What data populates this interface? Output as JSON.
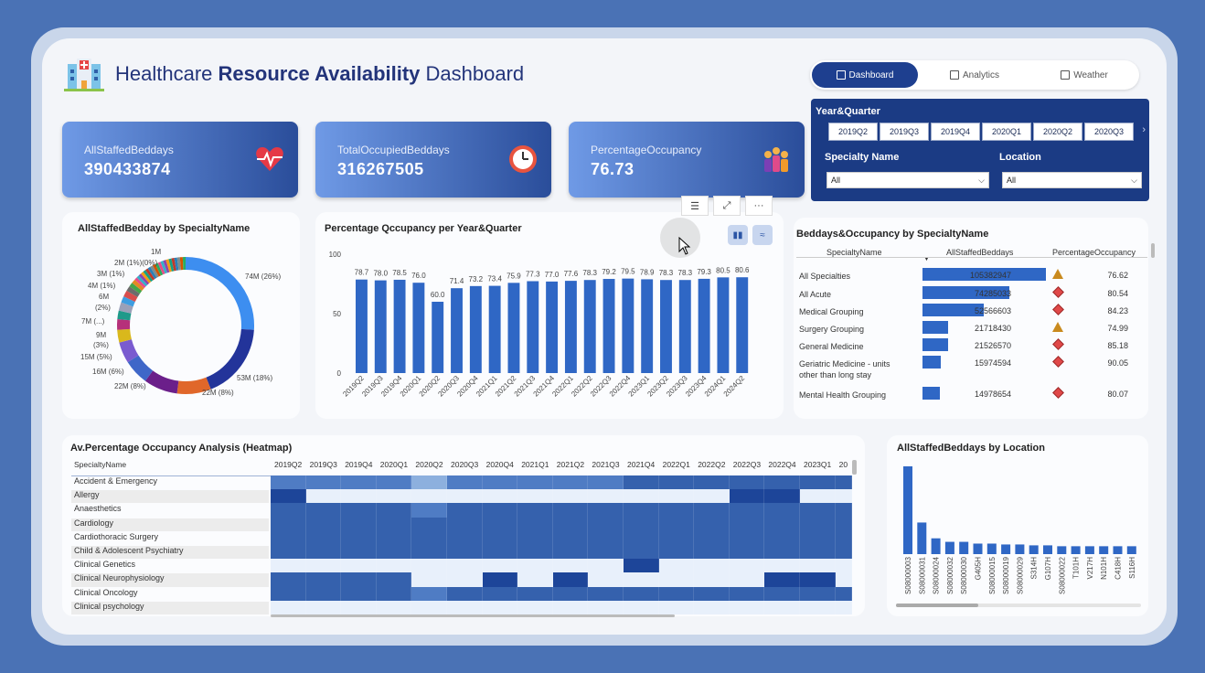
{
  "header": {
    "title_pre": "Healthcare ",
    "title_bold": "Resource Availability",
    "title_post": " Dashboard"
  },
  "nav": {
    "items": [
      {
        "label": "Dashboard",
        "icon": "bar-chart-icon",
        "active": true
      },
      {
        "label": "Analytics",
        "icon": "analytics-icon",
        "active": false
      },
      {
        "label": "Weather",
        "icon": "document-icon",
        "active": false
      }
    ]
  },
  "kpis": [
    {
      "label": "AllStaffedBeddays",
      "value": "390433874",
      "icon": "heart-pulse-icon"
    },
    {
      "label": "TotalOccupiedBeddays",
      "value": "316267505",
      "icon": "clock-icon"
    },
    {
      "label": "PercentageOccupancy",
      "value": "76.73",
      "icon": "people-icon"
    }
  ],
  "filters": {
    "year_quarter_label": "Year&Quarter",
    "quarters": [
      "2019Q2",
      "2019Q3",
      "2019Q4",
      "2020Q1",
      "2020Q2",
      "2020Q3"
    ],
    "specialty_label": "Specialty Name",
    "specialty_value": "All",
    "location_label": "Location",
    "location_value": "All"
  },
  "donut": {
    "title": "AllStaffedBedday by SpecialtyName",
    "labels": [
      "74M (26%)",
      "53M (18%)",
      "22M (8%)",
      "22M (8%)",
      "16M (6%)",
      "15M (5%)",
      "9M",
      "(3%)",
      "7M (...)",
      "6M",
      "(2%)",
      "4M (1%)",
      "3M (1%)",
      "2M (1%)(0%)",
      "1M"
    ],
    "colors": {
      "primary": "#3d8ef0",
      "navy": "#23349a",
      "orange": "#e0672a",
      "purple": "#6b1f8a",
      "blue2": "#3f67c8"
    }
  },
  "occupancy_chart": {
    "title": "Percentage Qccupancy per Year&Quarter",
    "chart_data": {
      "type": "bar",
      "categories": [
        "2019Q2",
        "2019Q3",
        "2019Q4",
        "2020Q1",
        "2020Q2",
        "2020Q3",
        "2020Q4",
        "2021Q1",
        "2021Q2",
        "2021Q3",
        "2021Q4",
        "2022Q1",
        "2022Q2",
        "2022Q3",
        "2022Q4",
        "2023Q1",
        "2023Q2",
        "2023Q3",
        "2023Q4",
        "2024Q1",
        "2024Q2"
      ],
      "values": [
        78.7,
        78.0,
        78.5,
        76.0,
        60.0,
        71.4,
        73.2,
        73.4,
        75.9,
        77.3,
        77.0,
        77.6,
        78.3,
        79.2,
        79.5,
        78.9,
        78.3,
        78.3,
        79.3,
        80.5,
        80.6
      ],
      "ylim": [
        0,
        100
      ],
      "yticks": [
        "0",
        "50",
        "100"
      ],
      "color": "#2f67c5"
    }
  },
  "table": {
    "title": "Beddays&Occupancy by SpecialtyName",
    "columns": [
      "SpecialtyName",
      "AllStaffedBeddays",
      "PercentageOccupancy"
    ],
    "rows": [
      {
        "name": "All Specialties",
        "beddays": "105382947",
        "beddays_num": 105382947,
        "occ": "76.62",
        "status": "triangle"
      },
      {
        "name": "All Acute",
        "beddays": "74285033",
        "beddays_num": 74285033,
        "occ": "80.54",
        "status": "diamond"
      },
      {
        "name": "Medical Grouping",
        "beddays": "52566603",
        "beddays_num": 52566603,
        "occ": "84.23",
        "status": "diamond"
      },
      {
        "name": "Surgery Grouping",
        "beddays": "21718430",
        "beddays_num": 21718430,
        "occ": "74.99",
        "status": "triangle"
      },
      {
        "name": "General Medicine",
        "beddays": "21526570",
        "beddays_num": 21526570,
        "occ": "85.18",
        "status": "diamond"
      },
      {
        "name": "Geriatric Medicine - units other than long stay",
        "beddays": "15974594",
        "beddays_num": 15974594,
        "occ": "90.05",
        "status": "diamond"
      },
      {
        "name": "Mental Health Grouping",
        "beddays": "14978654",
        "beddays_num": 14978654,
        "occ": "80.07",
        "status": "diamond"
      }
    ]
  },
  "heatmap": {
    "title": "Av.Percentage Occupancy Analysis (Heatmap)",
    "corner": "SpecialtyName",
    "columns": [
      "2019Q2",
      "2019Q3",
      "2019Q4",
      "2020Q1",
      "2020Q2",
      "2020Q3",
      "2020Q4",
      "2021Q1",
      "2021Q2",
      "2021Q3",
      "2021Q4",
      "2022Q1",
      "2022Q2",
      "2022Q3",
      "2022Q4",
      "2023Q1",
      "20"
    ],
    "rows": [
      "Accident & Emergency",
      "Allergy",
      "Anaesthetics",
      "Cardiology",
      "Cardiothoracic Surgery",
      "Child & Adolescent Psychiatry",
      "Clinical Genetics",
      "Clinical Neurophysiology",
      "Clinical Oncology",
      "Clinical psychology"
    ],
    "levels": [
      [
        2,
        2,
        2,
        2,
        1,
        2,
        2,
        2,
        2,
        2,
        3,
        3,
        3,
        3,
        3,
        3,
        3
      ],
      [
        4,
        0,
        0,
        0,
        0,
        0,
        0,
        0,
        0,
        0,
        0,
        0,
        0,
        4,
        4,
        0,
        0
      ],
      [
        3,
        3,
        3,
        3,
        2,
        3,
        3,
        3,
        3,
        3,
        3,
        3,
        3,
        3,
        3,
        3,
        3
      ],
      [
        3,
        3,
        3,
        3,
        3,
        3,
        3,
        3,
        3,
        3,
        3,
        3,
        3,
        3,
        3,
        3,
        3
      ],
      [
        3,
        3,
        3,
        3,
        3,
        3,
        3,
        3,
        3,
        3,
        3,
        3,
        3,
        3,
        3,
        3,
        3
      ],
      [
        3,
        3,
        3,
        3,
        3,
        3,
        3,
        3,
        3,
        3,
        3,
        3,
        3,
        3,
        3,
        3,
        3
      ],
      [
        0,
        0,
        0,
        0,
        0,
        0,
        0,
        0,
        0,
        0,
        4,
        0,
        0,
        0,
        0,
        0,
        0
      ],
      [
        3,
        3,
        3,
        3,
        0,
        0,
        4,
        0,
        4,
        0,
        0,
        0,
        0,
        0,
        4,
        4,
        0
      ],
      [
        3,
        3,
        3,
        3,
        2,
        3,
        3,
        3,
        3,
        3,
        3,
        3,
        3,
        3,
        3,
        3,
        3
      ],
      [
        0,
        0,
        0,
        0,
        0,
        0,
        0,
        0,
        0,
        0,
        0,
        0,
        0,
        0,
        0,
        0,
        0
      ]
    ],
    "palette": [
      "#e8f0fb",
      "#8db0de",
      "#4f7cc4",
      "#3561ad",
      "#1d4599"
    ]
  },
  "location_chart": {
    "title": "AllStaffedBeddays by Location",
    "chart_data": {
      "type": "bar",
      "categories": [
        "S08000003",
        "S08000031",
        "S08000024",
        "S08000032",
        "S08000030",
        "G405H",
        "S08000015",
        "S08000019",
        "S08000029",
        "S314H",
        "G107H",
        "S08000022",
        "T101H",
        "V217H",
        "N101H",
        "C418H",
        "S116H"
      ],
      "values": [
        100,
        36,
        18,
        14,
        14,
        12,
        12,
        11,
        11,
        10,
        10,
        9,
        9,
        9,
        9,
        9,
        9
      ],
      "color": "#2f67c5"
    }
  },
  "toolbar": {
    "filter_icon": "filter-icon",
    "expand_icon": "expand-icon",
    "more_label": "···"
  }
}
